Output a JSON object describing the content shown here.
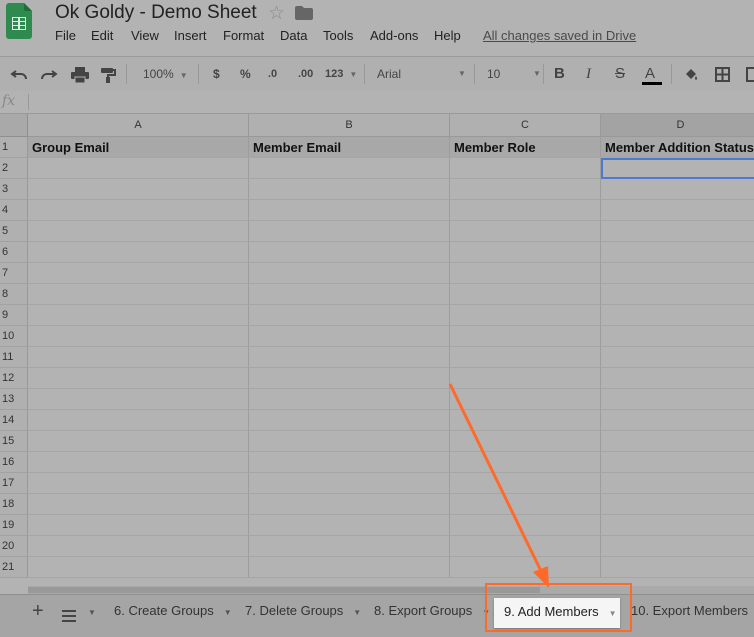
{
  "document": {
    "title": "Ok Goldy - Demo Sheet"
  },
  "menu": {
    "items": [
      "File",
      "Edit",
      "View",
      "Insert",
      "Format",
      "Data",
      "Tools",
      "Add-ons",
      "Help"
    ],
    "status": "All changes saved in Drive"
  },
  "toolbar": {
    "zoom": "100%",
    "currency": "$",
    "percent": "%",
    "decrease_decimals": ".0",
    "increase_decimals": ".00",
    "more_formats": "123",
    "font": "Arial",
    "font_size": "10",
    "bold": "B",
    "italic": "I",
    "strikethrough": "S",
    "text_color": "A"
  },
  "formula_bar": {
    "label": "fx",
    "value": ""
  },
  "grid": {
    "columns": [
      "A",
      "B",
      "C",
      "D"
    ],
    "rows": [
      "1",
      "2",
      "3",
      "4",
      "5",
      "6",
      "7",
      "8",
      "9",
      "10",
      "11",
      "12",
      "13",
      "14",
      "15",
      "16",
      "17",
      "18",
      "19",
      "20",
      "21"
    ],
    "headers": [
      "Group Email",
      "Member Email",
      "Member Role",
      "Member Addition Status"
    ],
    "active_column": "D",
    "selected_cell": "D2"
  },
  "sheet_tabs": {
    "tabs": [
      "6. Create Groups",
      "7. Delete Groups",
      "8. Export Groups",
      "9. Add Members",
      "10. Export Members"
    ],
    "active": "9. Add Members"
  },
  "colors": {
    "highlight": "#ff6a2b",
    "sheets_green": "#0f9d58",
    "selection": "#4a7bd0"
  }
}
